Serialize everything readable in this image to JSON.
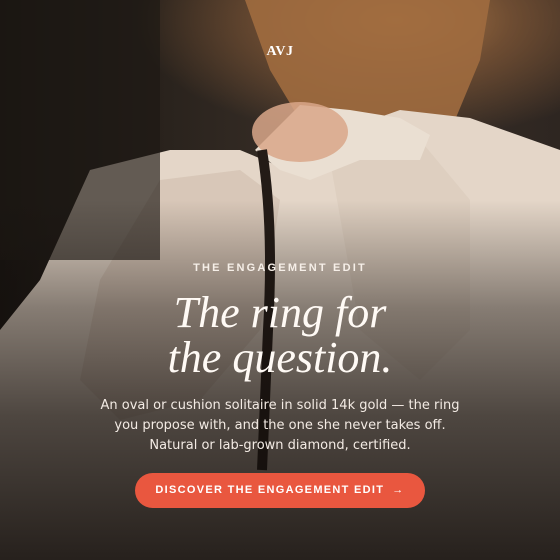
{
  "brand": {
    "logo_text": "AVJ"
  },
  "hero": {
    "eyebrow": "THE ENGAGEMENT EDIT",
    "headline_line1": "The ring for",
    "headline_line2": "the question.",
    "body_line1": "An oval or cushion solitaire in solid 14k gold — the ring",
    "body_line2": "you propose with, and the one she never takes off.",
    "body_line3": "Natural or lab-grown diamond, certified.",
    "cta_label": "DISCOVER THE ENGAGEMENT EDIT",
    "cta_arrow": "→"
  },
  "colors": {
    "accent": "#e9573f",
    "text": "#ffffff",
    "background": "#1b1511"
  }
}
